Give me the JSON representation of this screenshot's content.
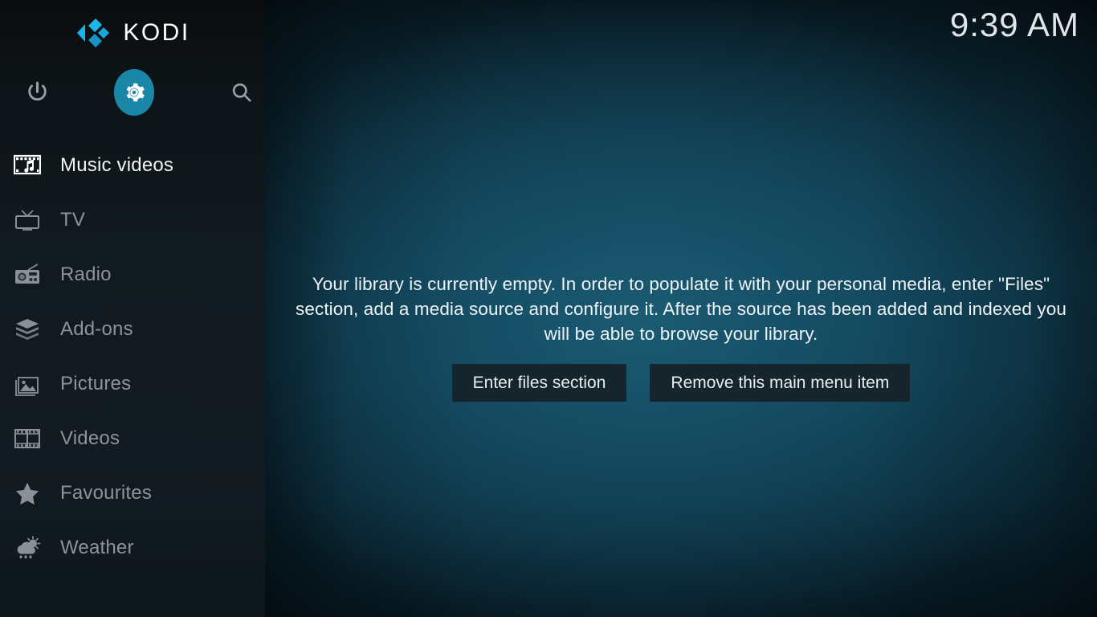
{
  "app": {
    "brand_name": "KODI",
    "logo_icon": "kodi-logo-icon"
  },
  "clock": {
    "time": "9:39 AM"
  },
  "sidebar": {
    "system_buttons": [
      {
        "name": "power",
        "icon": "power-icon",
        "label": "Power"
      },
      {
        "name": "settings",
        "icon": "gear-icon",
        "label": "Settings",
        "active": true,
        "accent": "#1a87a8"
      },
      {
        "name": "search",
        "icon": "search-icon",
        "label": "Search"
      }
    ],
    "items": [
      {
        "label": "Music videos",
        "icon": "music-video-icon",
        "selected": true
      },
      {
        "label": "TV",
        "icon": "tv-icon",
        "selected": false
      },
      {
        "label": "Radio",
        "icon": "radio-icon",
        "selected": false
      },
      {
        "label": "Add-ons",
        "icon": "addons-box-icon",
        "selected": false
      },
      {
        "label": "Pictures",
        "icon": "pictures-icon",
        "selected": false
      },
      {
        "label": "Videos",
        "icon": "videos-filmstrip-icon",
        "selected": false
      },
      {
        "label": "Favourites",
        "icon": "star-icon",
        "selected": false
      },
      {
        "label": "Weather",
        "icon": "weather-cloud-sun-icon",
        "selected": false
      }
    ]
  },
  "main": {
    "empty_message": "Your library is currently empty. In order to populate it with your personal media, enter \"Files\" section, add a media source and configure it. After the source has been added and indexed you will be able to browse your library.",
    "buttons": [
      {
        "label": "Enter files section"
      },
      {
        "label": "Remove this main menu item"
      }
    ]
  },
  "colors": {
    "accent": "#1a87a8",
    "logo_blue": "#17b2e7",
    "sidebar_bg": "#121a1f",
    "button_bg": "#16242c",
    "background_teal": "#10465c"
  }
}
